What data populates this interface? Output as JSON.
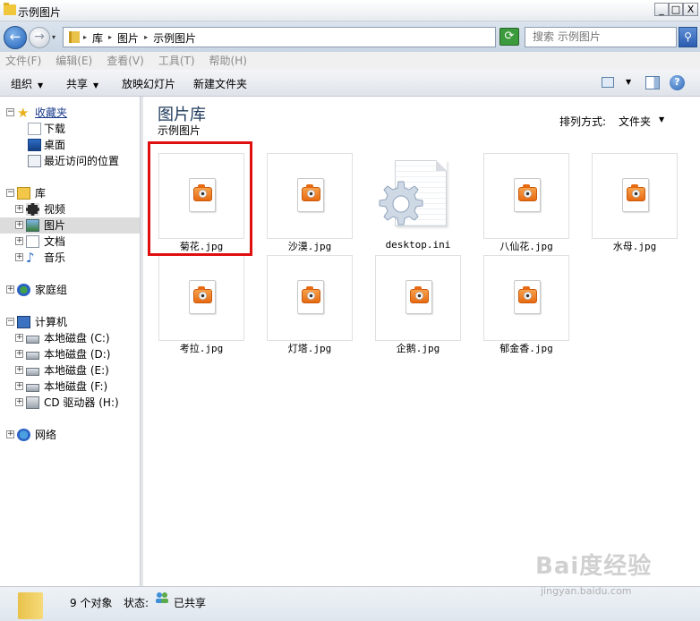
{
  "window": {
    "title": "示例图片",
    "min_label": "_",
    "max_label": "□",
    "close_label": "X"
  },
  "address": {
    "back_label": "←",
    "forward_label": "→",
    "drop_label": "▾",
    "crumbs": [
      "库",
      "图片",
      "示例图片"
    ],
    "crumb_sep": "▸",
    "search_placeholder": "搜索 示例图片"
  },
  "menu": [
    "文件(F)",
    "编辑(E)",
    "查看(V)",
    "工具(T)",
    "帮助(H)"
  ],
  "toolbar": {
    "organize": "组织",
    "share": "共享",
    "slideshow": "放映幻灯片",
    "new_folder": "新建文件夹",
    "help": "?"
  },
  "nav": {
    "favorites": "收藏夹",
    "downloads": "下载",
    "desktop": "桌面",
    "recent": "最近访问的位置",
    "libraries": "库",
    "videos": "视频",
    "pictures": "图片",
    "documents": "文档",
    "music": "音乐",
    "homegroup": "家庭组",
    "computer": "计算机",
    "drives": [
      "本地磁盘 (C:)",
      "本地磁盘 (D:)",
      "本地磁盘 (E:)",
      "本地磁盘 (F:)",
      "CD 驱动器 (H:)"
    ],
    "network": "网络"
  },
  "content": {
    "title": "图片库",
    "subtitle": "示例图片",
    "arrange_label": "排列方式:",
    "arrange_value": "文件夹",
    "files": [
      "菊花.jpg",
      "沙漠.jpg",
      "desktop.ini",
      "八仙花.jpg",
      "水母.jpg",
      "考拉.jpg",
      "灯塔.jpg",
      "企鹅.jpg",
      "郁金香.jpg"
    ]
  },
  "status": {
    "count": "9 个对象",
    "state_label": "状态:",
    "state_value": "已共享"
  },
  "watermark": {
    "logo": "Bai度经验",
    "url": "jingyan.baidu.com"
  },
  "colors": {
    "highlight": "#e00f0f",
    "library_title": "#1e395b",
    "camera": "#e76a12"
  }
}
